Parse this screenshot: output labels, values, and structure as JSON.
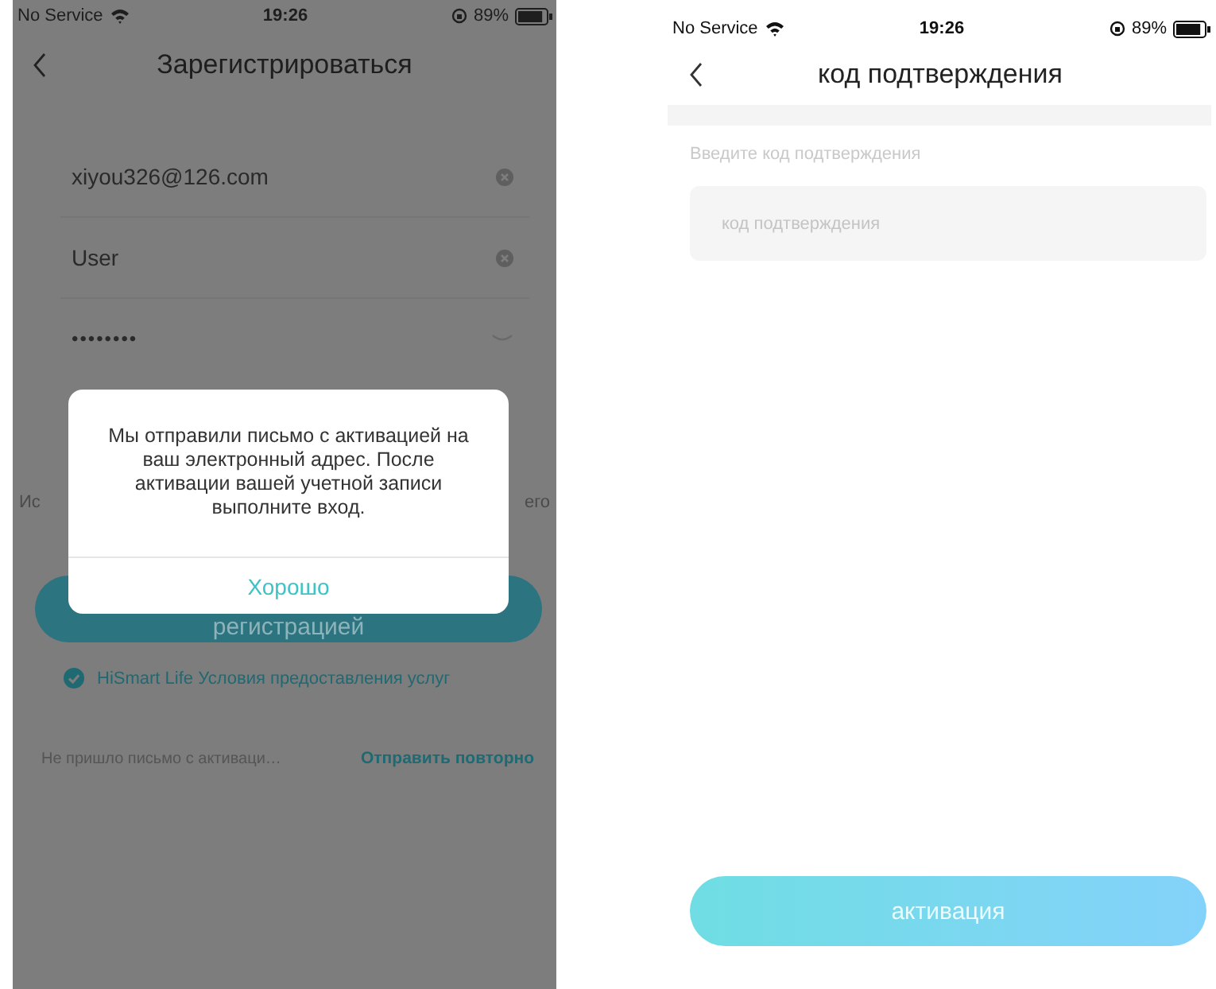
{
  "registration_screen": {
    "status_bar": {
      "carrier": "No Service",
      "time": "19:26",
      "battery": "89%"
    },
    "title": "Зарегистрироваться",
    "fields": [
      {
        "kind": "text",
        "value": "xiyou326@126.com"
      },
      {
        "kind": "text",
        "value": "User"
      },
      {
        "kind": "password",
        "value": "••••••••"
      }
    ],
    "notice_fragments": [
      "Ис",
      "его"
    ],
    "register_button": {
      "label": "регистрацией"
    },
    "terms": {
      "checked": true,
      "label": "HiSmart Life Условия предоставления услуг"
    },
    "resend": {
      "text": "Не пришло письмо с активаци…",
      "link": "Отправить повторно"
    },
    "dialog": {
      "message": "Мы отправили письмо с активацией на ваш электронный адрес. После активации вашей учетной записи выполните вход.",
      "button": "Хорошо"
    }
  },
  "verification_screen": {
    "status_bar": {
      "carrier": "No Service",
      "time": "19:26",
      "battery": "89%"
    },
    "title": "код подтверждения",
    "prompt": "Введите код подтверждения",
    "code_field": {
      "placeholder": "код подтверждения"
    },
    "activate_button": {
      "label": "активация"
    }
  }
}
